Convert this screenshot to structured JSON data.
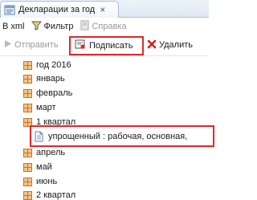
{
  "tab": {
    "title": "Декларации за год",
    "close_glyph": "×",
    "icon": "declarations-tab-icon"
  },
  "toolbar1": {
    "xml_label": "В xml",
    "filter_label": "Фильтр",
    "help_label": "Справка"
  },
  "toolbar2": {
    "send_label": "Отправить",
    "sign_label": "Подписать",
    "delete_label": "Удалить"
  },
  "tree": {
    "year": "год 2016",
    "months_top": [
      "январь",
      "февраль",
      "март"
    ],
    "quarter1": "1 квартал",
    "document": "упрощенный : рабочая,  основная,",
    "months_bottom": [
      "апрель",
      "май",
      "июнь"
    ],
    "quarter2": "2 квартал"
  },
  "colors": {
    "highlight": "#e0262a",
    "folder_orange": "#c9742a",
    "tab_border": "#a9bcd3"
  }
}
